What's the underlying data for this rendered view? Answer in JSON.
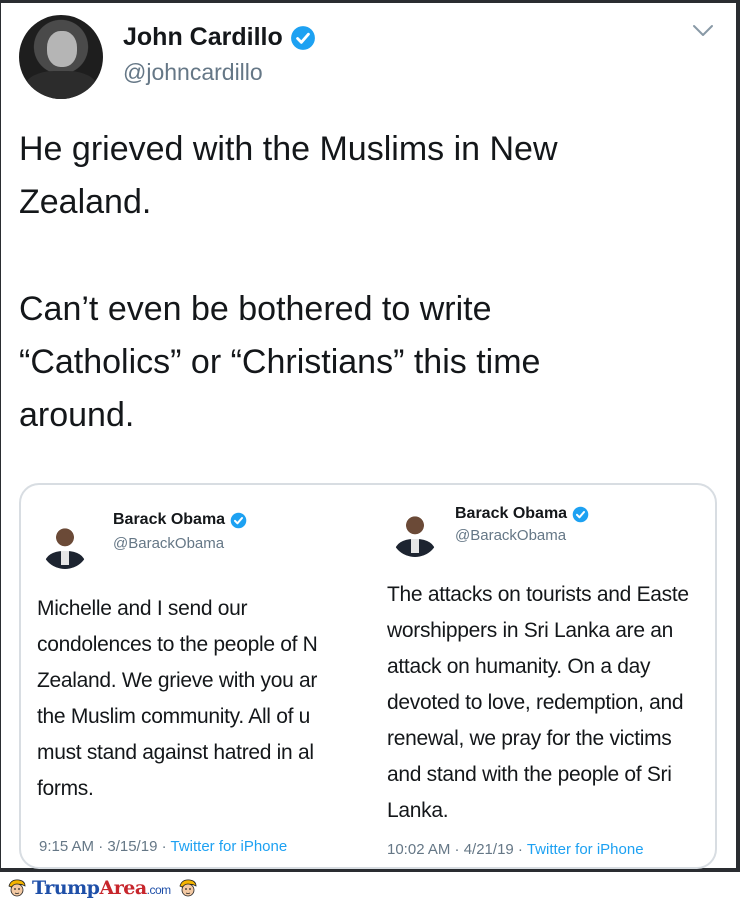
{
  "tweet": {
    "author_name": "John Cardillo",
    "author_handle": "@johncardillo",
    "text_lines_1": [
      "He grieved with the Muslims in New",
      "Zealand."
    ],
    "text_lines_2": [
      "Can’t even be bothered to write",
      "“Catholics” or “Christians” this time",
      "around."
    ]
  },
  "embedded": {
    "left": {
      "name": "Barack Obama",
      "handle": "@BarackObama",
      "lines": [
        "Michelle and I send our",
        "condolences to the people of N",
        "Zealand. We grieve with you ar",
        "the Muslim community. All of u",
        "must stand against hatred in al",
        "forms."
      ],
      "time": "9:15 AM · 3/15/19 · ",
      "source": "Twitter for iPhone"
    },
    "right": {
      "name": "Barack Obama",
      "handle": "@BarackObama",
      "lines": [
        "The attacks on tourists and Easte",
        "worshippers in Sri Lanka are an",
        "attack on humanity. On a day",
        "devoted to love, redemption, and",
        "renewal, we pray for the victims",
        "and stand with the people of Sri",
        "Lanka."
      ],
      "time": "10:02 AM · 4/21/19 · ",
      "source": "Twitter for iPhone"
    }
  },
  "footer": {
    "brand_part1": "Trump",
    "brand_part2": "Area",
    "brand_part3": ".com"
  },
  "colors": {
    "verified_blue": "#1da1f2",
    "secondary_text": "#657786",
    "brand_blue": "#1e4fa8",
    "brand_red": "#c7262c"
  },
  "icons": [
    "verified-badge-icon",
    "chevron-down-icon",
    "cartoon-head-icon"
  ]
}
